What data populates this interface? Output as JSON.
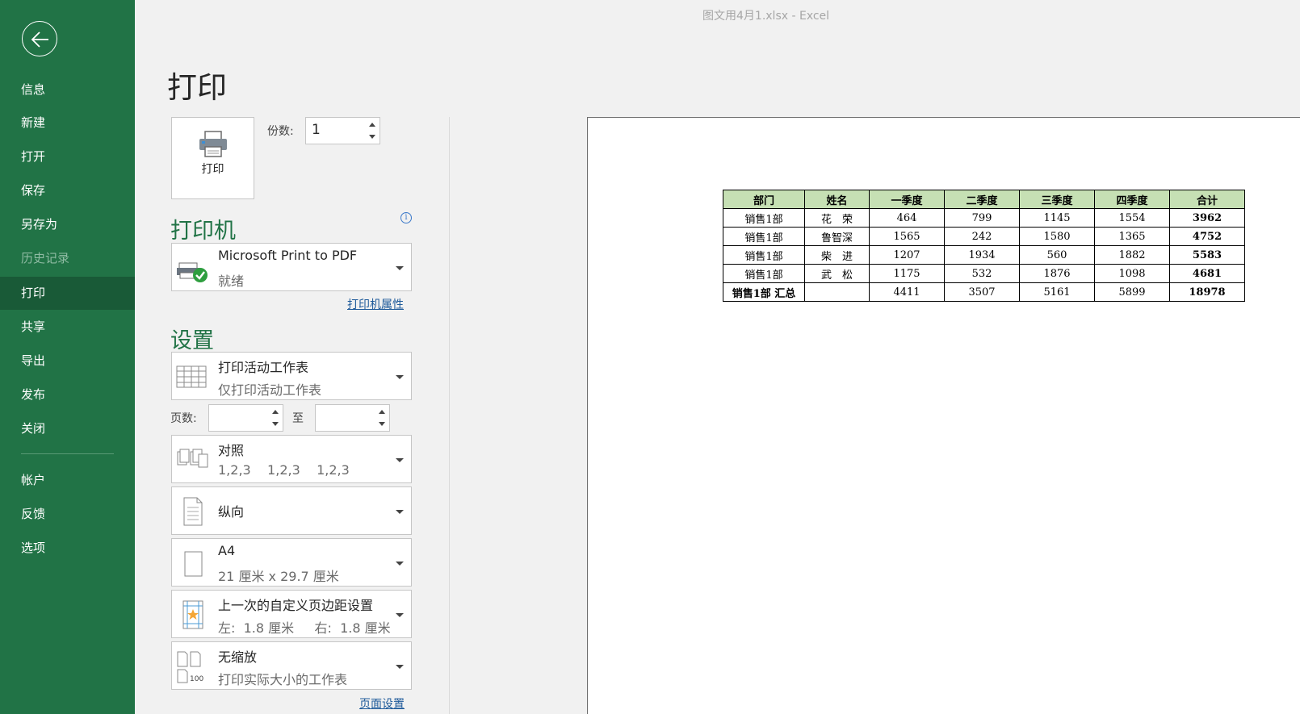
{
  "window_title": "图文用4月1.xlsx  -  Excel",
  "nav": {
    "items": [
      "信息",
      "新建",
      "打开",
      "保存",
      "另存为",
      "历史记录",
      "打印",
      "共享",
      "导出",
      "发布",
      "关闭"
    ],
    "bottom_items": [
      "帐户",
      "反馈",
      "选项"
    ]
  },
  "page_title": "打印",
  "print_button_label": "打印",
  "copies": {
    "label": "份数:",
    "value": "1"
  },
  "printer": {
    "heading": "打印机",
    "name": "Microsoft Print to PDF",
    "status": "就绪",
    "properties_link": "打印机属性"
  },
  "settings": {
    "heading": "设置",
    "what": {
      "main": "打印活动工作表",
      "sub": "仅打印活动工作表"
    },
    "pages_label": "页数:",
    "to_label": "至",
    "collate": {
      "main": "对照",
      "sub": "1,2,3    1,2,3    1,2,3"
    },
    "orientation": {
      "main": "纵向"
    },
    "paper": {
      "main": "A4",
      "sub": "21 厘米 x 29.7 厘米"
    },
    "margins": {
      "main": "上一次的自定义页边距设置",
      "sub": "左:  1.8 厘米     右:  1.8 厘米"
    },
    "scaling": {
      "main": "无缩放",
      "sub": "打印实际大小的工作表",
      "icon_text": "100"
    },
    "page_setup_link": "页面设置"
  },
  "sheet": {
    "headers": [
      "部门",
      "姓名",
      "一季度",
      "二季度",
      "三季度",
      "四季度",
      "合计"
    ],
    "rows": [
      [
        "销售1部",
        "花　荣",
        "464",
        "799",
        "1145",
        "1554",
        "3962"
      ],
      [
        "销售1部",
        "鲁智深",
        "1565",
        "242",
        "1580",
        "1365",
        "4752"
      ],
      [
        "销售1部",
        "柴　进",
        "1207",
        "1934",
        "560",
        "1882",
        "5583"
      ],
      [
        "销售1部",
        "武　松",
        "1175",
        "532",
        "1876",
        "1098",
        "4681"
      ],
      [
        "销售1部 汇总",
        "",
        "4411",
        "3507",
        "5161",
        "5899",
        "18978"
      ]
    ]
  },
  "colors": {
    "sidebar": "#217346",
    "sidebar_active": "#195a37",
    "header_fill": "#c6e0b4",
    "accent": "#217346"
  }
}
